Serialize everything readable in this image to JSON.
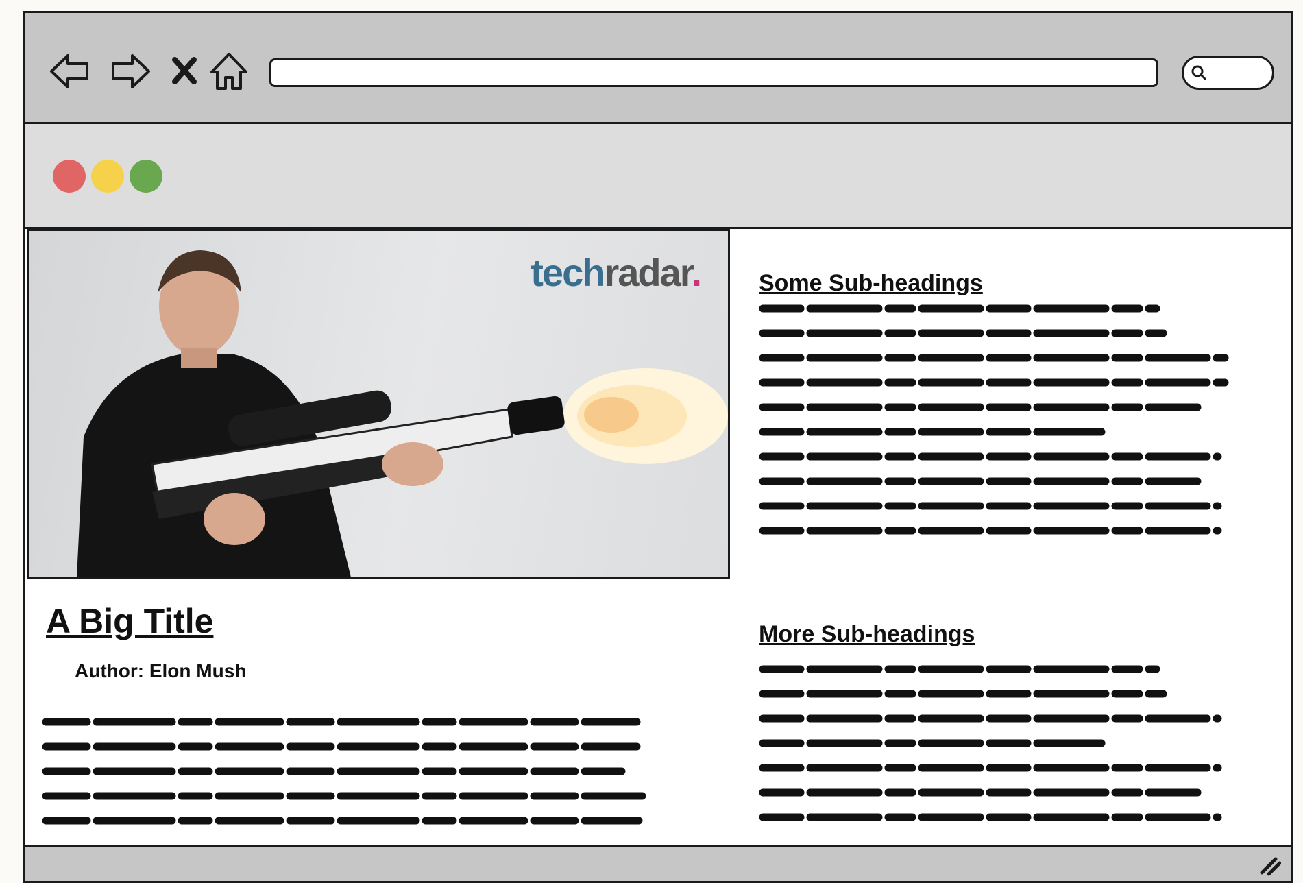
{
  "browser": {
    "nav_icons": [
      "back-arrow-icon",
      "forward-arrow-icon",
      "close-x-icon",
      "home-icon"
    ],
    "url_value": "",
    "search_icon": "magnifier-icon",
    "window_dots": {
      "red": "#e06666",
      "yellow": "#f6d24a",
      "green": "#6aa84f"
    }
  },
  "hero": {
    "logo_part1": "tech",
    "logo_part2": "radar",
    "logo_dot": ".",
    "alt": "photo-placeholder"
  },
  "article": {
    "title": "A Big Title",
    "author": "Author: Elon Mush"
  },
  "sidebar": {
    "sections": [
      {
        "heading": "Some Sub-headings"
      },
      {
        "heading": "More Sub-headings"
      }
    ]
  },
  "colors": {
    "toolbar": "#c6c6c6",
    "tabbar": "#dddddd",
    "frame": "#1a1a1a",
    "logo_blue": "#3a6e8f",
    "logo_pink": "#c8357a"
  }
}
